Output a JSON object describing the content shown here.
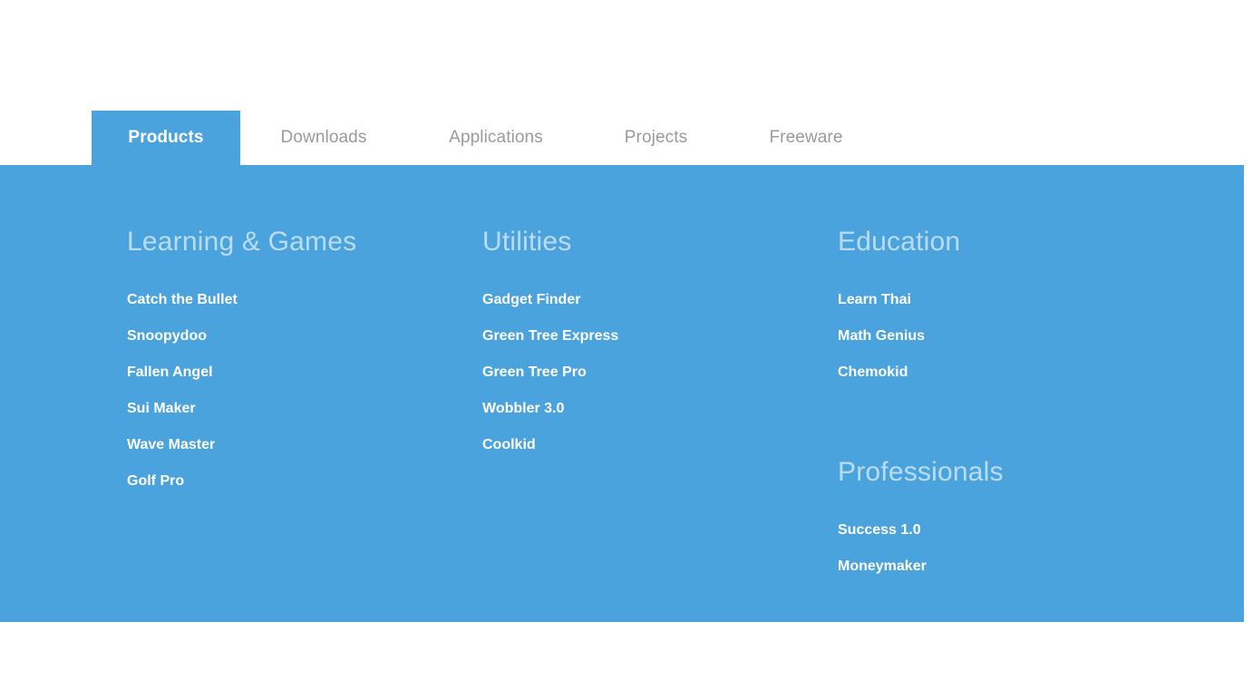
{
  "colors": {
    "panel_blue": "#4aa3dc",
    "active_tab_blue": "#4aa3dc",
    "inactive_tab_text": "#9a9a9a",
    "heading_text": "rgba(255,255,255,0.62)",
    "link_text": "#ffffff",
    "page_background": "#ffffff"
  },
  "tabs": [
    {
      "label": "Products",
      "active": true
    },
    {
      "label": "Downloads",
      "active": false
    },
    {
      "label": "Applications",
      "active": false
    },
    {
      "label": "Projects",
      "active": false
    },
    {
      "label": "Freeware",
      "active": false
    }
  ],
  "megamenu": {
    "columns": [
      {
        "groups": [
          {
            "heading": "Learning & Games",
            "links": [
              "Catch the Bullet",
              "Snoopydoo",
              "Fallen Angel",
              "Sui Maker",
              "Wave Master",
              "Golf Pro"
            ]
          }
        ]
      },
      {
        "groups": [
          {
            "heading": "Utilities",
            "links": [
              "Gadget Finder",
              "Green Tree Express",
              "Green Tree Pro",
              "Wobbler 3.0",
              "Coolkid"
            ]
          }
        ]
      },
      {
        "groups": [
          {
            "heading": "Education",
            "links": [
              "Learn Thai",
              "Math Genius",
              "Chemokid"
            ]
          },
          {
            "heading": "Professionals",
            "links": [
              "Success 1.0",
              "Moneymaker"
            ]
          }
        ]
      }
    ]
  }
}
